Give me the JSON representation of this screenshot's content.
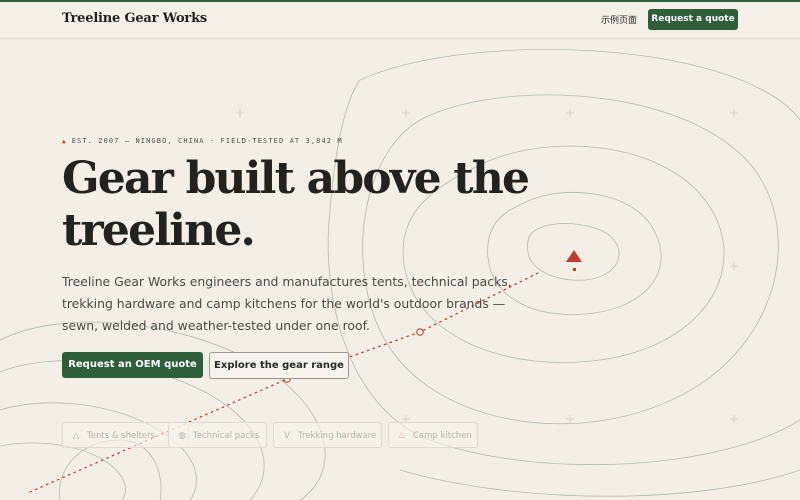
{
  "header": {
    "brand": "Treeline Gear Works",
    "nav_link": "示例页面",
    "cta_label": "Request a quote"
  },
  "hero": {
    "eyebrow": "EST. 2007 — NINGBO, CHINA · FIELD-TESTED AT 3,842 M",
    "headline_line1": "Gear built above the",
    "headline_line2": "treeline.",
    "lede": "Treeline Gear Works engineers and manufactures tents, technical packs, trekking hardware and camp kitchens for the world's outdoor brands — sewn, welded and weather-tested under one roof.",
    "primary_button": "Request an OEM quote",
    "secondary_button": "Explore the gear range"
  },
  "categories": [
    {
      "label": "Tents & shelters",
      "icon": "tent-icon"
    },
    {
      "label": "Technical packs",
      "icon": "backpack-icon"
    },
    {
      "label": "Trekking hardware",
      "icon": "trekking-poles-icon"
    },
    {
      "label": "Camp kitchen",
      "icon": "stove-icon"
    }
  ],
  "colors": {
    "accent_green": "#2f5e3a",
    "marker_red": "#c0392b",
    "background": "#f3efe6",
    "contour": "#a9b1a6"
  }
}
